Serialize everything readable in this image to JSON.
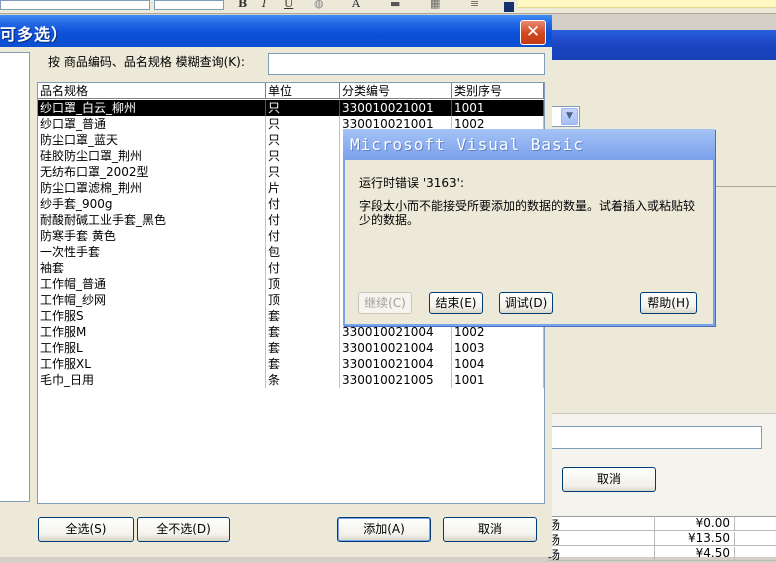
{
  "toolbar": {
    "glyph_bold": "B",
    "glyph_italic": "I",
    "glyph_underline": "U",
    "glyph_font_color": "A"
  },
  "background_window": {
    "cancel_label": "取消",
    "rows": [
      {
        "name": "场",
        "price": "¥0.00"
      },
      {
        "name": "场",
        "price": "¥13.50"
      },
      {
        "name": "场",
        "price": "¥4.50"
      }
    ]
  },
  "dialog": {
    "title": "可多选）",
    "search_label": "按 商品编码、品名规格 模糊查询(K):",
    "search_value": "",
    "columns": [
      "品名规格",
      "单位",
      "分类编号",
      "类别序号"
    ],
    "rows": [
      {
        "name": "纱口罩_白云_柳州",
        "unit": "只",
        "code": "330010021001",
        "seq": "1001"
      },
      {
        "name": "纱口罩_普通",
        "unit": "只",
        "code": "330010021001",
        "seq": "1002"
      },
      {
        "name": "防尘口罩_蓝天",
        "unit": "只",
        "code": "",
        "seq": ""
      },
      {
        "name": "硅胶防尘口罩_荆州",
        "unit": "只",
        "code": "",
        "seq": ""
      },
      {
        "name": "无纺布口罩_2002型",
        "unit": "只",
        "code": "",
        "seq": ""
      },
      {
        "name": "防尘口罩滤棉_荆州",
        "unit": "片",
        "code": "",
        "seq": ""
      },
      {
        "name": "纱手套_900g",
        "unit": "付",
        "code": "",
        "seq": ""
      },
      {
        "name": "耐酸耐碱工业手套_黑色",
        "unit": "付",
        "code": "",
        "seq": ""
      },
      {
        "name": "防寒手套  黄色",
        "unit": "付",
        "code": "",
        "seq": ""
      },
      {
        "name": "一次性手套",
        "unit": "包",
        "code": "",
        "seq": ""
      },
      {
        "name": "袖套",
        "unit": "付",
        "code": "",
        "seq": ""
      },
      {
        "name": "工作帽_普通",
        "unit": "顶",
        "code": "",
        "seq": ""
      },
      {
        "name": "工作帽_纱网",
        "unit": "顶",
        "code": "",
        "seq": ""
      },
      {
        "name": "工作服S",
        "unit": "套",
        "code": "",
        "seq": ""
      },
      {
        "name": "工作服M",
        "unit": "套",
        "code": "330010021004",
        "seq": "1002"
      },
      {
        "name": "工作服L",
        "unit": "套",
        "code": "330010021004",
        "seq": "1003"
      },
      {
        "name": "工作服XL",
        "unit": "套",
        "code": "330010021004",
        "seq": "1004"
      },
      {
        "name": "毛巾_日用",
        "unit": "条",
        "code": "330010021005",
        "seq": "1001"
      }
    ],
    "buttons": {
      "select_all": "全选(S)",
      "select_none": "全不选(D)",
      "add": "添加(A)",
      "cancel": "取消"
    },
    "close_glyph": "✕"
  },
  "vb_error": {
    "title": "Microsoft Visual Basic",
    "message_line1": "运行时错误 '3163':",
    "message_line2": "字段太小而不能接受所要添加的数据的数量。试着插入或粘贴较少的数据。",
    "buttons": {
      "continue": "继续(C)",
      "end": "结束(E)",
      "debug": "调试(D)",
      "help": "帮助(H)"
    }
  }
}
